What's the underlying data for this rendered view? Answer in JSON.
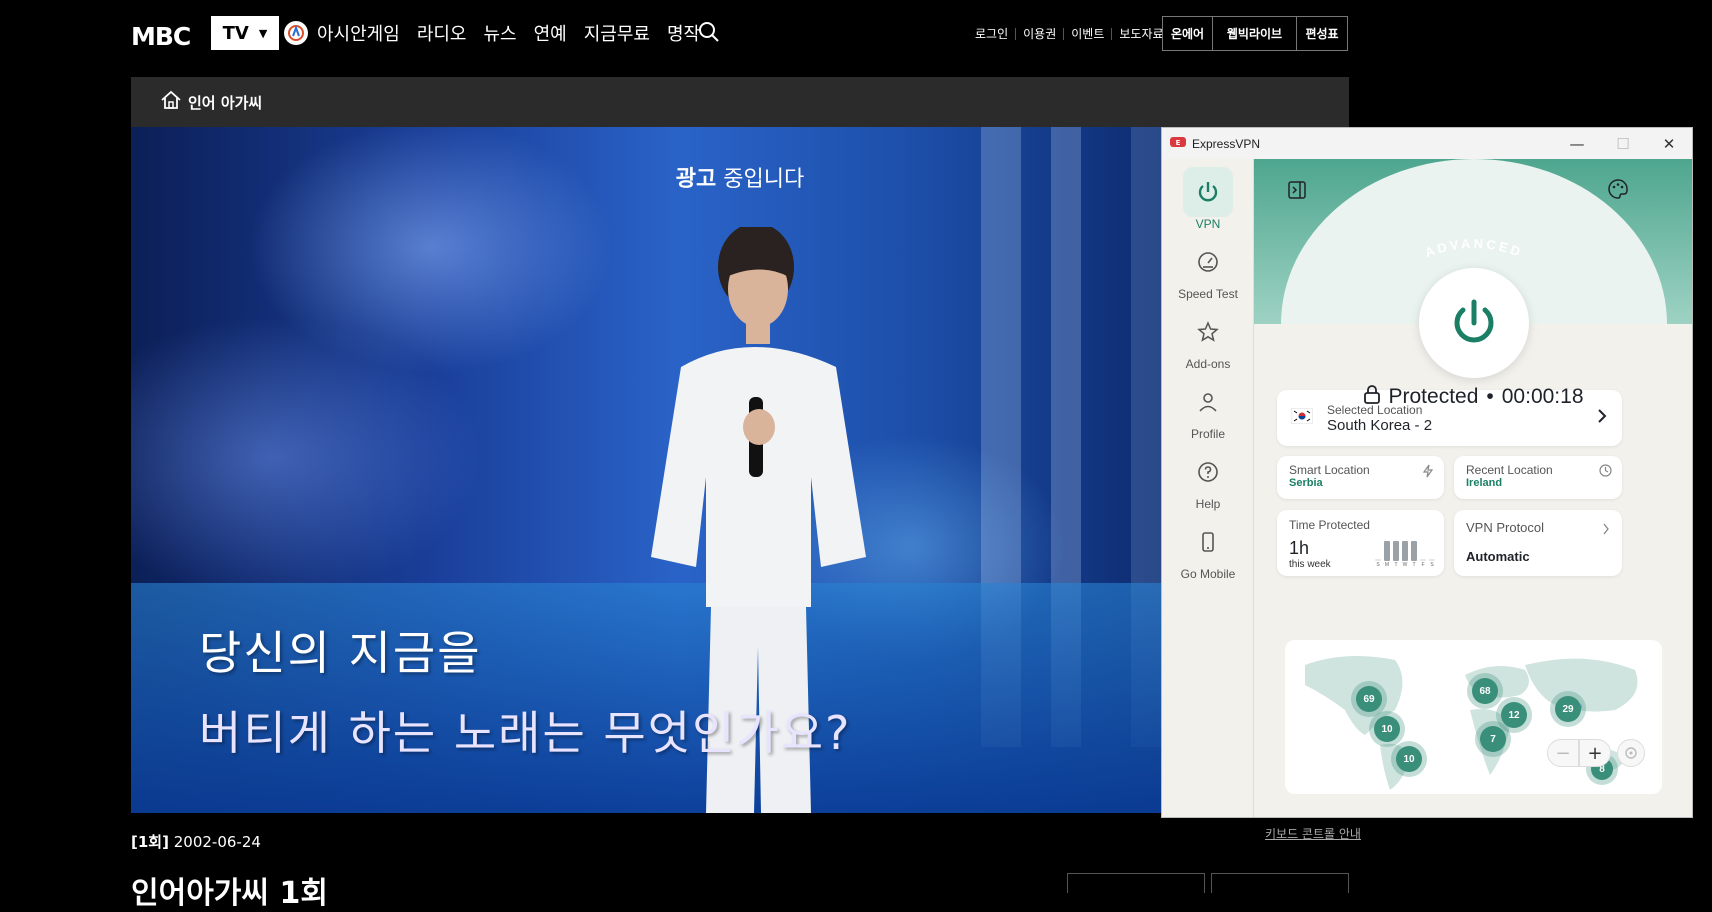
{
  "header": {
    "logo": "MBC",
    "tv_label": "TV",
    "tv_arrow": "▼",
    "nav": [
      "아시안게임",
      "라디오",
      "뉴스",
      "연예",
      "지금무료",
      "명작"
    ],
    "util_links": [
      "로그인",
      "이용권",
      "이벤트",
      "보도자료"
    ],
    "util_boxes": [
      "온에어",
      "웹빅라이브",
      "편성표"
    ]
  },
  "player": {
    "program_title": "인어 아가씨",
    "ad_bold": "광고",
    "ad_rest": " 중입니다",
    "subtitle_line1": "당신의 지금을",
    "subtitle_line2": "버티게 하는 노래는 무엇인가요?"
  },
  "episode": {
    "number": "[1회]",
    "date": "2002-06-24",
    "keyboard_link": "키보드 콘트롤 안내",
    "title": "인어아가씨 1회"
  },
  "vpn": {
    "app_title": "ExpressVPN",
    "sidebar": [
      {
        "label": "VPN",
        "icon": "power-icon",
        "active": true
      },
      {
        "label": "Speed Test",
        "icon": "speedometer-icon",
        "active": false
      },
      {
        "label": "Add-ons",
        "icon": "star-icon",
        "active": false
      },
      {
        "label": "Profile",
        "icon": "person-icon",
        "active": false
      },
      {
        "label": "Help",
        "icon": "help-icon",
        "active": false
      },
      {
        "label": "Go Mobile",
        "icon": "phone-icon",
        "active": false
      }
    ],
    "badge": "ADVANCED",
    "status": "Protected",
    "timer": "00:00:18",
    "selected_location_label": "Selected Location",
    "selected_location": "South Korea - 2",
    "smart_location_label": "Smart Location",
    "smart_location": "Serbia",
    "recent_location_label": "Recent Location",
    "recent_location": "Ireland",
    "time_protected_label": "Time Protected",
    "time_protected_value": "1h",
    "time_protected_sub": "this week",
    "week_days": [
      "S",
      "M",
      "T",
      "W",
      "T",
      "F",
      "S"
    ],
    "week_levels": [
      0,
      0.9,
      0.9,
      0.9,
      0.9,
      0,
      0
    ],
    "vpn_protocol_label": "VPN Protocol",
    "vpn_protocol": "Automatic",
    "map_counts": [
      "69",
      "10",
      "10",
      "68",
      "12",
      "7",
      "29",
      "8"
    ],
    "zoom_minus": "−",
    "zoom_plus": "+",
    "accent": "#1a7f64"
  }
}
